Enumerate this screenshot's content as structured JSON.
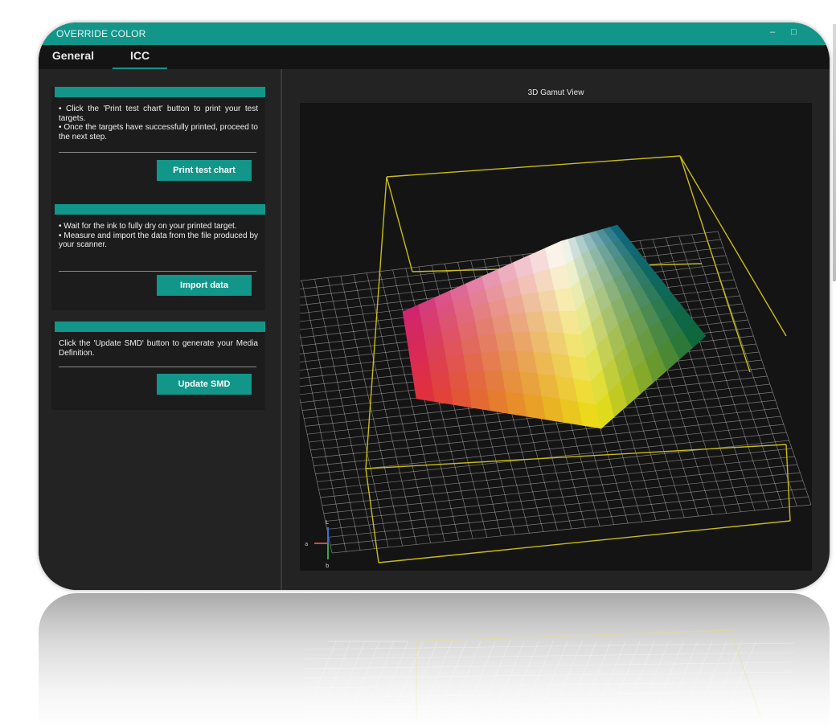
{
  "window": {
    "title": "OVERRIDE COLOR",
    "minimize_glyph": "–",
    "restore_glyph": "□"
  },
  "tabs": [
    {
      "label": "General"
    },
    {
      "label": "ICC"
    }
  ],
  "steps": [
    {
      "lines": [
        "• Click the 'Print test chart' button to print your test targets.",
        "• Once the targets have successfully printed, proceed to the next step."
      ],
      "button": "Print test chart"
    },
    {
      "lines": [
        "• Wait for the ink to fully dry on your printed target.",
        "• Measure and import the data from the file produced by your scanner."
      ],
      "button": "Import data"
    },
    {
      "lines": [
        "Click the 'Update SMD' button to generate your Media Definition."
      ],
      "button": "Update SMD"
    }
  ],
  "viewer": {
    "title": "3D Gamut View",
    "axes": {
      "l": "L",
      "a": "a",
      "b": "b"
    }
  },
  "colors": {
    "accent": "#12968a",
    "window_bg": "#232323",
    "viewport_bg": "#141414",
    "bounding_box": "#c8bd16",
    "grid": "#cfcfcf"
  }
}
